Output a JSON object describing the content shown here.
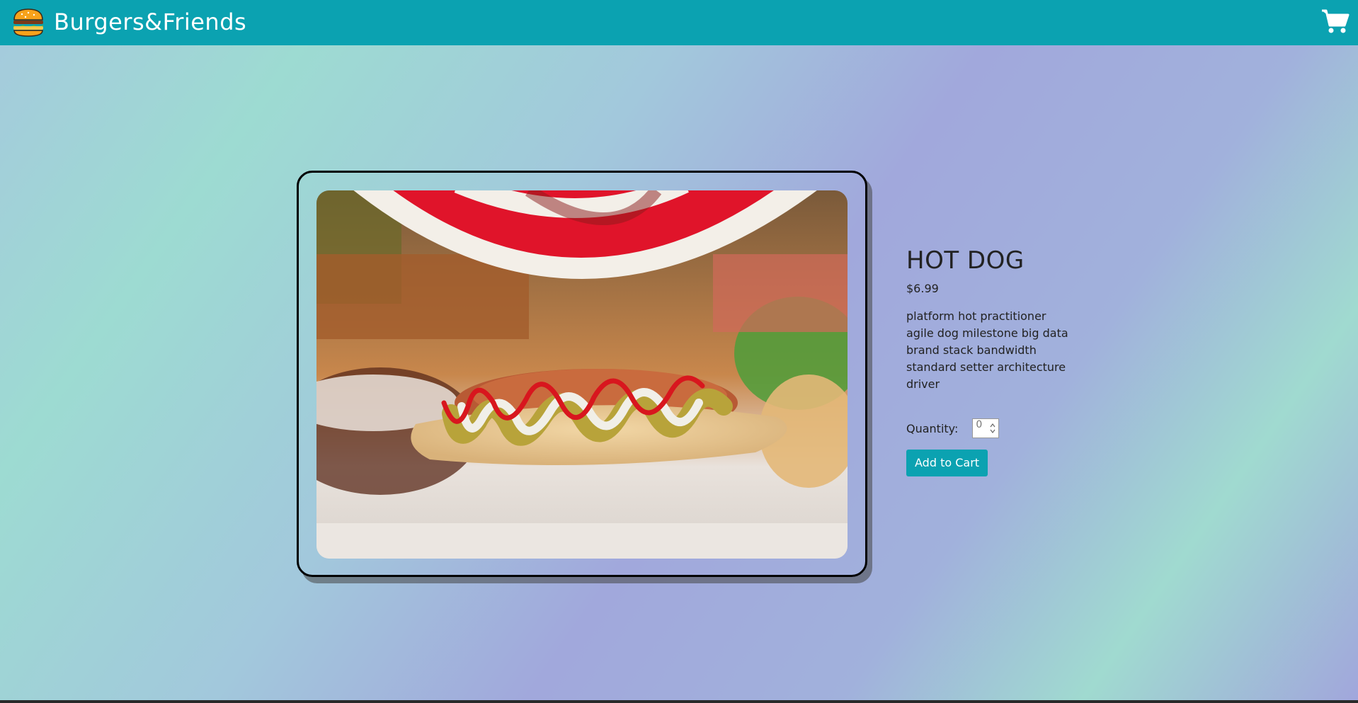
{
  "header": {
    "brand": "Burgers&Friends",
    "logo_icon": "burger-icon",
    "cart_icon": "shopping-cart-icon",
    "bg_color": "#0ba2b1"
  },
  "product": {
    "title": "HOT DOG",
    "price": "$6.99",
    "description": "platform hot practitioner agile dog milestone big data brand stack bandwidth standard setter architecture driver",
    "quantity_label": "Quantity:",
    "quantity_value": "0",
    "add_to_cart": "Add to Cart",
    "image": "hot-dog-photo"
  }
}
